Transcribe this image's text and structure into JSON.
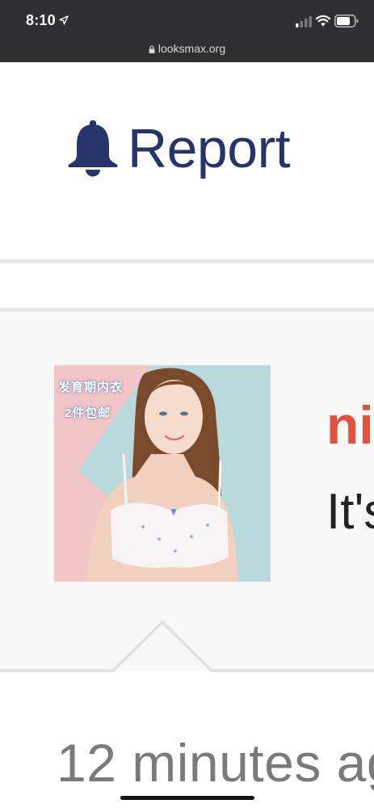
{
  "status_bar": {
    "time": "8:10",
    "url": "looksmax.org"
  },
  "header": {
    "title": "Report",
    "icon": "bell-icon",
    "color": "#27346b"
  },
  "notification": {
    "image_caption_line1": "发育期内衣",
    "image_caption_line2": "2件包邮",
    "title_fragment": "ni",
    "body_fragment": "It's",
    "title_color": "#e0513f"
  },
  "timestamp": "12 minutes ag"
}
